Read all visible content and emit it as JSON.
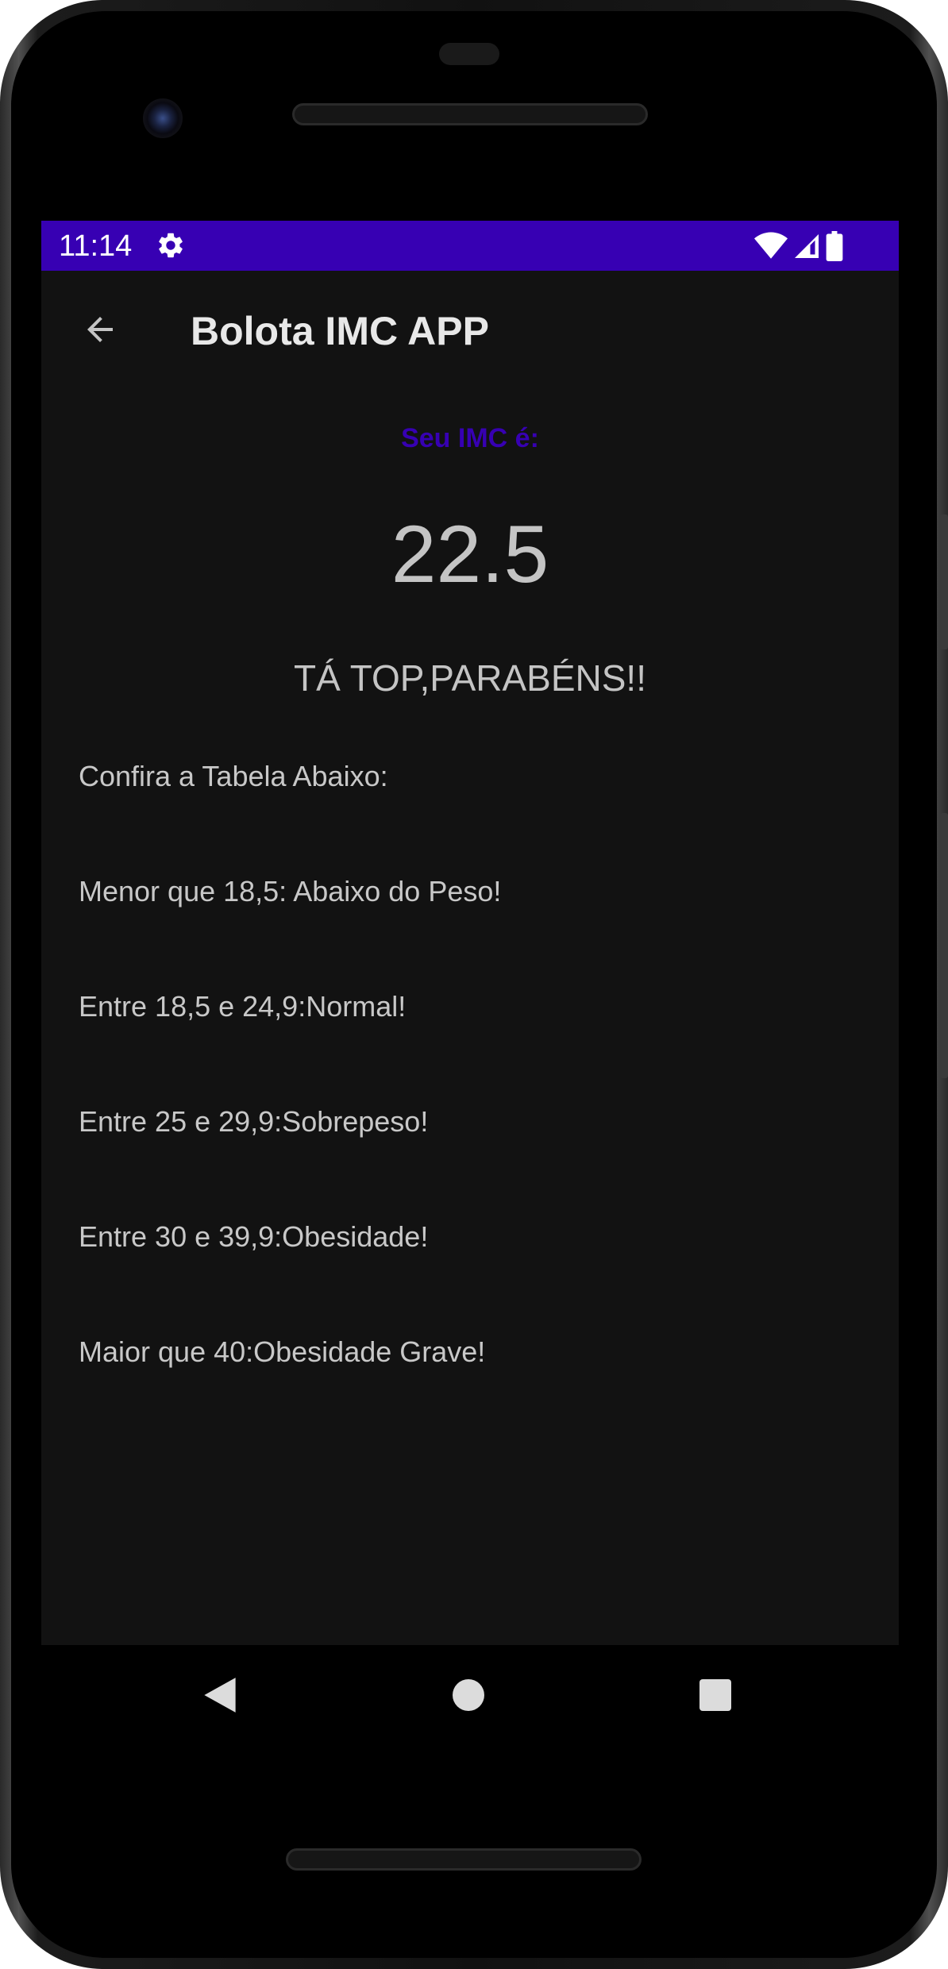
{
  "status_bar": {
    "time": "11:14",
    "icons": [
      "gear-icon",
      "wifi-icon",
      "signal-icon",
      "battery-icon"
    ],
    "color": "#3700b3"
  },
  "app_bar": {
    "title": "Bolota IMC APP",
    "back_icon": "arrow-back-icon"
  },
  "result": {
    "label": "Seu IMC é:",
    "value": "22.5",
    "status": "TÁ TOP,PARABÉNS!!"
  },
  "table": {
    "header": "Confira a Tabela Abaixo:",
    "rows": [
      "Menor que 18,5: Abaixo do Peso!",
      "Entre 18,5 e 24,9:Normal!",
      "Entre 25 e 29,9:Sobrepeso!",
      "Entre 30 e 39,9:Obesidade!",
      "Maior que 40:Obesidade Grave!"
    ]
  },
  "navigation": {
    "buttons": [
      "back-nav-icon",
      "home-nav-icon",
      "recents-nav-icon"
    ]
  },
  "colors": {
    "accent": "#3700b3",
    "background": "#121212",
    "text": "#c8c8c8"
  }
}
